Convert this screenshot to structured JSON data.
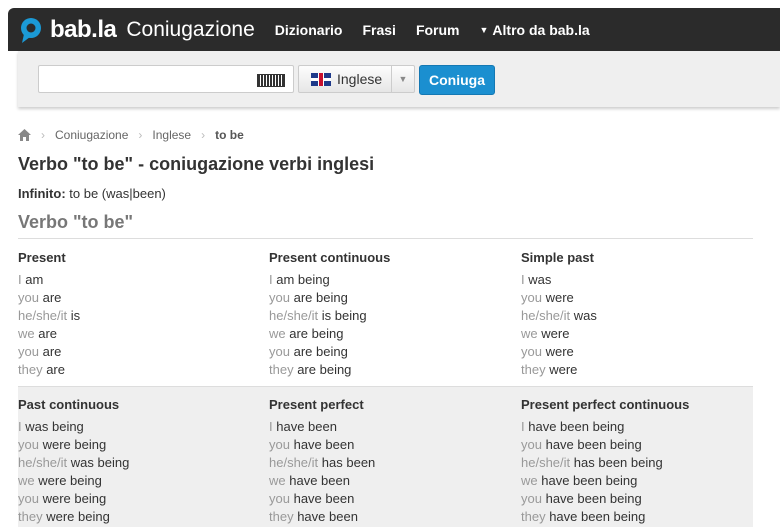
{
  "header": {
    "logo_text": "bab.la",
    "section": "Coniugazione",
    "nav": [
      "Dizionario",
      "Frasi",
      "Forum"
    ],
    "more": "Altro da bab.la"
  },
  "search": {
    "value": "",
    "language": "Inglese",
    "button": "Coniuga",
    "keyboard_icon": "keyboard-icon",
    "flag_icon": "uk-flag-icon"
  },
  "breadcrumb": [
    "Coniugazione",
    "Inglese",
    "to be"
  ],
  "page_title": "Verbo \"to be\" - coniugazione verbi inglesi",
  "infinitive_label": "Infinito:",
  "infinitive_value": "to be (was|been)",
  "section_title": "Verbo \"to be\"",
  "tenses": [
    {
      "name": "Present",
      "lines": [
        [
          "I",
          "am"
        ],
        [
          "you",
          "are"
        ],
        [
          "he/she/it",
          "is"
        ],
        [
          "we",
          "are"
        ],
        [
          "you",
          "are"
        ],
        [
          "they",
          "are"
        ]
      ]
    },
    {
      "name": "Present continuous",
      "lines": [
        [
          "I",
          "am being"
        ],
        [
          "you",
          "are being"
        ],
        [
          "he/she/it",
          "is being"
        ],
        [
          "we",
          "are being"
        ],
        [
          "you",
          "are being"
        ],
        [
          "they",
          "are being"
        ]
      ]
    },
    {
      "name": "Simple past",
      "lines": [
        [
          "I",
          "was"
        ],
        [
          "you",
          "were"
        ],
        [
          "he/she/it",
          "was"
        ],
        [
          "we",
          "were"
        ],
        [
          "you",
          "were"
        ],
        [
          "they",
          "were"
        ]
      ]
    },
    {
      "name": "Past continuous",
      "lines": [
        [
          "I",
          "was being"
        ],
        [
          "you",
          "were being"
        ],
        [
          "he/she/it",
          "was being"
        ],
        [
          "we",
          "were being"
        ],
        [
          "you",
          "were being"
        ],
        [
          "they",
          "were being"
        ]
      ]
    },
    {
      "name": "Present perfect",
      "lines": [
        [
          "I",
          "have been"
        ],
        [
          "you",
          "have been"
        ],
        [
          "he/she/it",
          "has been"
        ],
        [
          "we",
          "have been"
        ],
        [
          "you",
          "have been"
        ],
        [
          "they",
          "have been"
        ]
      ]
    },
    {
      "name": "Present perfect continuous",
      "lines": [
        [
          "I",
          "have been being"
        ],
        [
          "you",
          "have been being"
        ],
        [
          "he/she/it",
          "has been being"
        ],
        [
          "we",
          "have been being"
        ],
        [
          "you",
          "have been being"
        ],
        [
          "they",
          "have been being"
        ]
      ]
    }
  ],
  "colors": {
    "topbar": "#2b2b2b",
    "accent": "#1b8fd0",
    "pronoun": "#999999"
  }
}
